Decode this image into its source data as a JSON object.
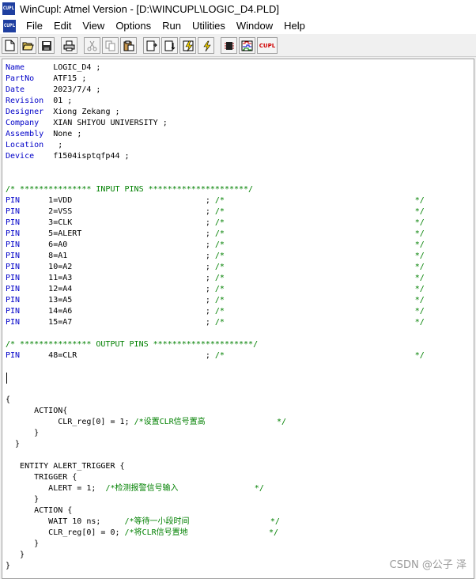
{
  "window": {
    "title": "WinCupl:  Atmel Version - [D:\\WINCUPL\\LOGIC_D4.PLD]",
    "icon_label": "CUPL"
  },
  "menu": [
    "File",
    "Edit",
    "View",
    "Options",
    "Run",
    "Utilities",
    "Window",
    "Help"
  ],
  "toolbar": [
    {
      "name": "new-file-icon"
    },
    {
      "name": "open-folder-icon"
    },
    {
      "name": "save-icon"
    },
    {
      "name": "print-icon"
    },
    {
      "name": "cut-icon"
    },
    {
      "name": "copy-icon"
    },
    {
      "name": "paste-icon"
    },
    {
      "name": "compile-icon"
    },
    {
      "name": "device-compile-icon"
    },
    {
      "name": "simulate-icon"
    },
    {
      "name": "device-simulate-icon"
    },
    {
      "name": "chip-view-icon"
    },
    {
      "name": "waveform-icon"
    },
    {
      "name": "cupl-icon",
      "label": "CUPL"
    }
  ],
  "code_lines": [
    [
      {
        "t": "kw",
        "s": "Name"
      },
      {
        "t": "n",
        "s": "      LOGIC_D4 ;"
      }
    ],
    [
      {
        "t": "kw",
        "s": "PartNo"
      },
      {
        "t": "n",
        "s": "    ATF15 ;"
      }
    ],
    [
      {
        "t": "kw",
        "s": "Date"
      },
      {
        "t": "n",
        "s": "      2023/7/4 ;"
      }
    ],
    [
      {
        "t": "kw",
        "s": "Revision"
      },
      {
        "t": "n",
        "s": "  01 ;"
      }
    ],
    [
      {
        "t": "kw",
        "s": "Designer"
      },
      {
        "t": "n",
        "s": "  Xiong Zekang ;"
      }
    ],
    [
      {
        "t": "kw",
        "s": "Company"
      },
      {
        "t": "n",
        "s": "   XIAN SHIYOU UNIVERSITY ;"
      }
    ],
    [
      {
        "t": "kw",
        "s": "Assembly"
      },
      {
        "t": "n",
        "s": "  None ;"
      }
    ],
    [
      {
        "t": "kw",
        "s": "Location"
      },
      {
        "t": "n",
        "s": "   ;"
      }
    ],
    [
      {
        "t": "kw",
        "s": "Device"
      },
      {
        "t": "n",
        "s": "    f1504isptqfp44 ;"
      }
    ],
    [],
    [],
    [
      {
        "t": "cm",
        "s": "/* *************** INPUT PINS *********************/"
      }
    ],
    [
      {
        "t": "kw",
        "s": "PIN"
      },
      {
        "t": "n",
        "s": "      1=VDD                            ; "
      },
      {
        "t": "cm",
        "s": "/*                                        */"
      }
    ],
    [
      {
        "t": "kw",
        "s": "PIN"
      },
      {
        "t": "n",
        "s": "      2=VSS                            ; "
      },
      {
        "t": "cm",
        "s": "/*                                        */"
      }
    ],
    [
      {
        "t": "kw",
        "s": "PIN"
      },
      {
        "t": "n",
        "s": "      3=CLK                            ; "
      },
      {
        "t": "cm",
        "s": "/*                                        */"
      }
    ],
    [
      {
        "t": "kw",
        "s": "PIN"
      },
      {
        "t": "n",
        "s": "      5=ALERT                          ; "
      },
      {
        "t": "cm",
        "s": "/*                                        */"
      }
    ],
    [
      {
        "t": "kw",
        "s": "PIN"
      },
      {
        "t": "n",
        "s": "      6=A0                             ; "
      },
      {
        "t": "cm",
        "s": "/*                                        */"
      }
    ],
    [
      {
        "t": "kw",
        "s": "PIN"
      },
      {
        "t": "n",
        "s": "      8=A1                             ; "
      },
      {
        "t": "cm",
        "s": "/*                                        */"
      }
    ],
    [
      {
        "t": "kw",
        "s": "PIN"
      },
      {
        "t": "n",
        "s": "      10=A2                            ; "
      },
      {
        "t": "cm",
        "s": "/*                                        */"
      }
    ],
    [
      {
        "t": "kw",
        "s": "PIN"
      },
      {
        "t": "n",
        "s": "      11=A3                            ; "
      },
      {
        "t": "cm",
        "s": "/*                                        */"
      }
    ],
    [
      {
        "t": "kw",
        "s": "PIN"
      },
      {
        "t": "n",
        "s": "      12=A4                            ; "
      },
      {
        "t": "cm",
        "s": "/*                                        */"
      }
    ],
    [
      {
        "t": "kw",
        "s": "PIN"
      },
      {
        "t": "n",
        "s": "      13=A5                            ; "
      },
      {
        "t": "cm",
        "s": "/*                                        */"
      }
    ],
    [
      {
        "t": "kw",
        "s": "PIN"
      },
      {
        "t": "n",
        "s": "      14=A6                            ; "
      },
      {
        "t": "cm",
        "s": "/*                                        */"
      }
    ],
    [
      {
        "t": "kw",
        "s": "PIN"
      },
      {
        "t": "n",
        "s": "      15=A7                            ; "
      },
      {
        "t": "cm",
        "s": "/*                                        */"
      }
    ],
    [],
    [
      {
        "t": "cm",
        "s": "/* *************** OUTPUT PINS *********************/"
      }
    ],
    [
      {
        "t": "kw",
        "s": "PIN"
      },
      {
        "t": "n",
        "s": "      48=CLR                           ; "
      },
      {
        "t": "cm",
        "s": "/*                                        */"
      }
    ],
    [],
    [],
    [],
    [
      {
        "t": "n",
        "s": "{"
      }
    ],
    [
      {
        "t": "n",
        "s": "      ACTION{"
      }
    ],
    [
      {
        "t": "n",
        "s": "           CLR_reg[0] = 1; "
      },
      {
        "t": "cm",
        "s": "/*设置CLR信号置高               */"
      }
    ],
    [
      {
        "t": "n",
        "s": "      }"
      }
    ],
    [
      {
        "t": "n",
        "s": "  }"
      }
    ],
    [],
    [
      {
        "t": "n",
        "s": "   ENTITY ALERT_TRIGGER {"
      }
    ],
    [
      {
        "t": "n",
        "s": "      TRIGGER {"
      }
    ],
    [
      {
        "t": "n",
        "s": "         ALERT = 1;  "
      },
      {
        "t": "cm",
        "s": "/*检测报警信号输入                */"
      }
    ],
    [
      {
        "t": "n",
        "s": "      }"
      }
    ],
    [
      {
        "t": "n",
        "s": "      ACTION {"
      }
    ],
    [
      {
        "t": "n",
        "s": "         WAIT 10 ns;     "
      },
      {
        "t": "cm",
        "s": "/*等待一小段时间                 */"
      }
    ],
    [
      {
        "t": "n",
        "s": "         CLR_reg[0] = 0; "
      },
      {
        "t": "cm",
        "s": "/*将CLR信号置地                 */"
      }
    ],
    [
      {
        "t": "n",
        "s": "      }"
      }
    ],
    [
      {
        "t": "n",
        "s": "   }"
      }
    ],
    [
      {
        "t": "n",
        "s": "}"
      }
    ]
  ],
  "watermark": "CSDN @公子 泽"
}
